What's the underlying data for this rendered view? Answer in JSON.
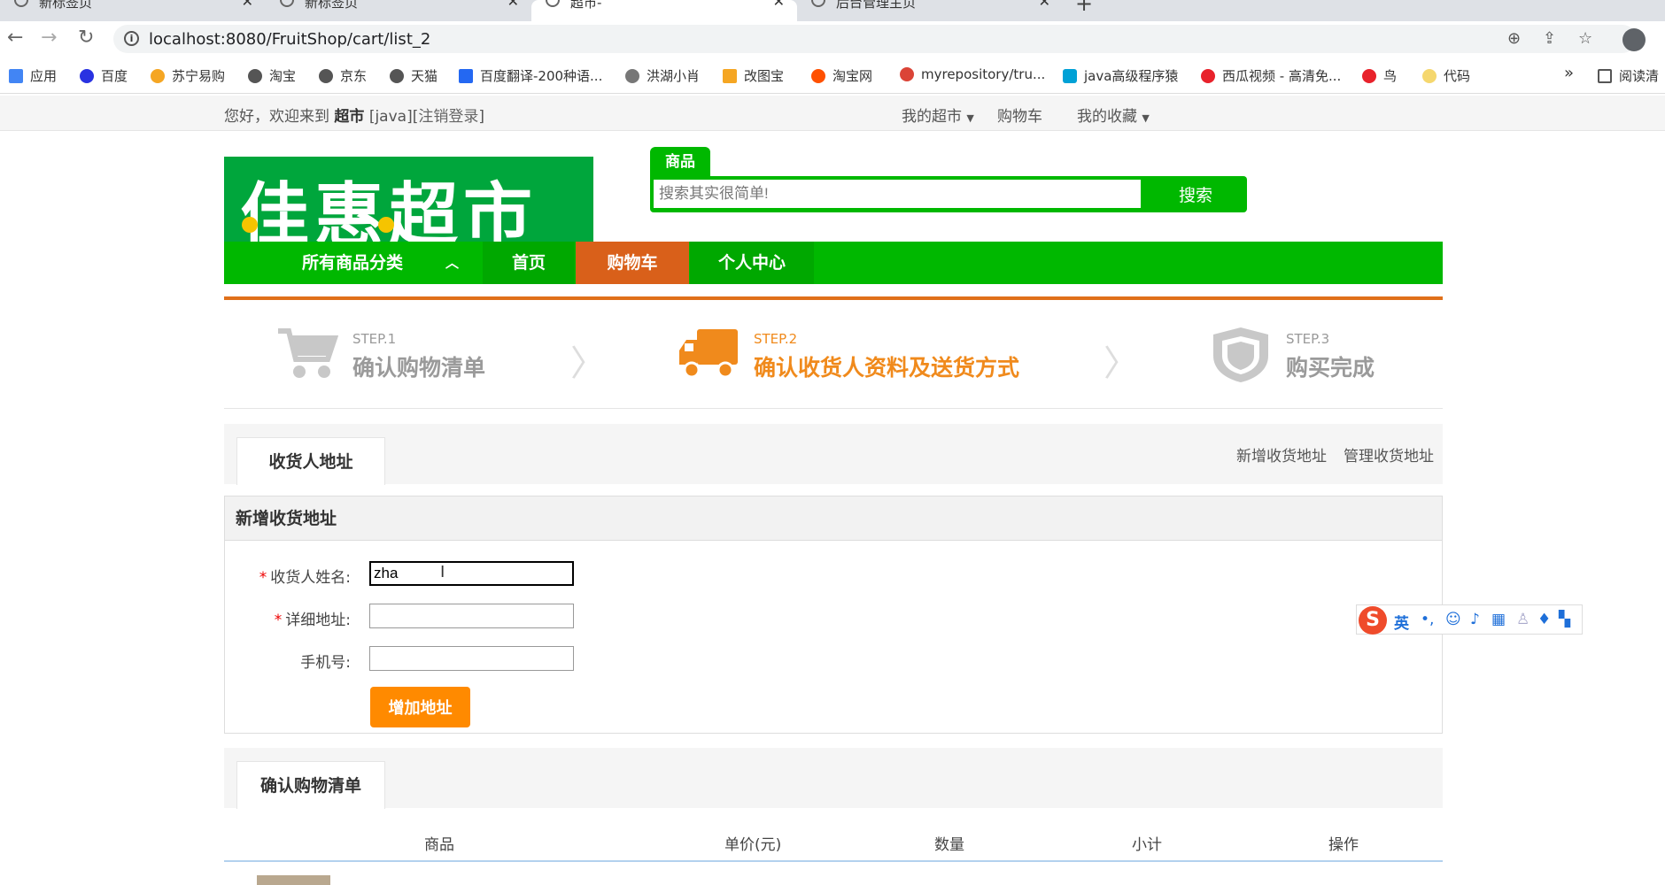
{
  "browser": {
    "tabs": [
      {
        "title": "新标签页"
      },
      {
        "title": "新标签页"
      },
      {
        "title": "超市-"
      },
      {
        "title": "后台管理主页"
      }
    ],
    "url": "localhost:8080/FruitShop/cart/list_2",
    "bookmarks": [
      {
        "label": "应用",
        "color": "#4285f4"
      },
      {
        "label": "百度",
        "color": "#2932e1"
      },
      {
        "label": "苏宁易购",
        "color": "#f5a623"
      },
      {
        "label": "淘宝",
        "color": "#555555"
      },
      {
        "label": "京东",
        "color": "#555555"
      },
      {
        "label": "天猫",
        "color": "#555555"
      },
      {
        "label": "百度翻译-200种语...",
        "color": "#2468f2"
      },
      {
        "label": "洪湖小肖",
        "color": "#777777"
      },
      {
        "label": "改图宝",
        "color": "#f5a623"
      },
      {
        "label": "淘宝网",
        "color": "#ff5000"
      },
      {
        "label": "myrepository/tru...",
        "color": "#db4437"
      },
      {
        "label": "java高级程序猿",
        "color": "#00a1d6"
      },
      {
        "label": "西瓜视频 - 高清免...",
        "color": "#e8222b"
      },
      {
        "label": "鸟",
        "color": "#e8222b"
      },
      {
        "label": "代码",
        "color": "#f5d76e"
      }
    ],
    "bookmarks_more": "»",
    "reading_list": "阅读清"
  },
  "sitebar": {
    "welcome_prefix": "您好，欢迎来到",
    "site_name": "超市",
    "user": "[java][",
    "logout": "注销登录",
    "close_bracket": "]",
    "my_market": "我的超市",
    "cart": "购物车",
    "favorites": "我的收藏"
  },
  "header": {
    "logo_text": "佳惠超市",
    "search_tab": "商品",
    "search_placeholder": "搜索其实很简单!",
    "search_button": "搜索"
  },
  "nav": {
    "all_categories": "所有商品分类",
    "home": "首页",
    "cart": "购物车",
    "personal": "个人中心"
  },
  "steps": [
    {
      "label": "STEP.1",
      "title": "确认购物清单",
      "active": false
    },
    {
      "label": "STEP.2",
      "title": "确认收货人资料及送货方式",
      "active": true
    },
    {
      "label": "STEP.3",
      "title": "购买完成",
      "active": false
    }
  ],
  "address_panel": {
    "tab": "收货人地址",
    "add_link": "新增收货地址",
    "manage_link": "管理收货地址"
  },
  "form": {
    "heading": "新增收货地址",
    "name_label": "收货人姓名:",
    "name_value": "zha",
    "address_label": "详细地址:",
    "address_value": "",
    "phone_label": "手机号:",
    "phone_value": "",
    "required_mark": "*",
    "submit": "增加地址"
  },
  "cart_panel": {
    "tab": "确认购物清单",
    "columns": [
      "商品",
      "单价(元)",
      "数量",
      "小计",
      "操作"
    ]
  },
  "ime": {
    "logo": "S",
    "lang": "英"
  },
  "colors": {
    "brand_green": "#00b800",
    "cart_orange": "#d9601a",
    "button_orange": "#ff8a00",
    "step_active": "#f08a1c",
    "step_inactive": "#9a9a9a"
  }
}
